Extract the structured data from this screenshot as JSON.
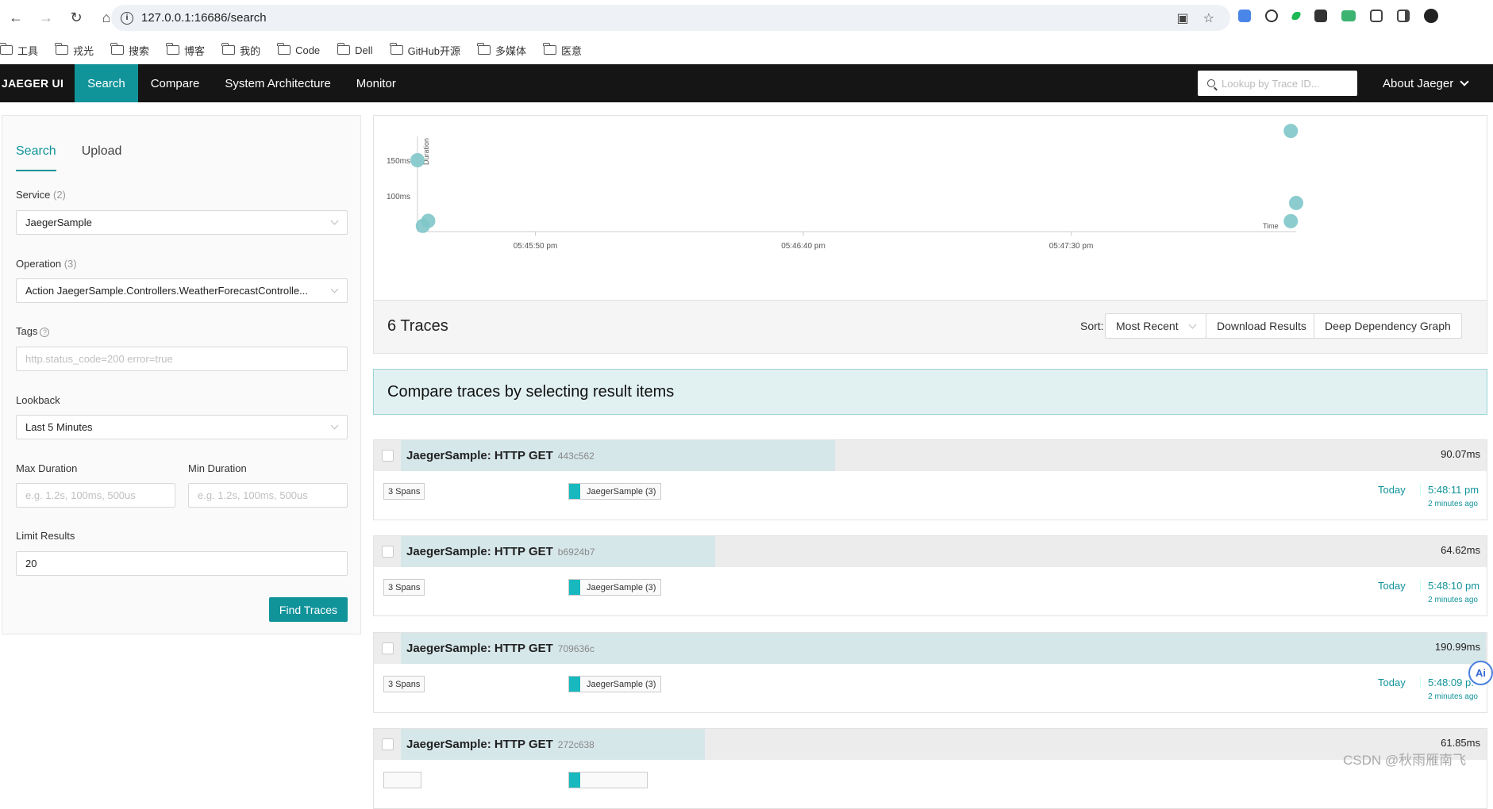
{
  "browser": {
    "url": "127.0.0.1:16686/search",
    "bookmarks": [
      "工具",
      "戎光",
      "搜索",
      "博客",
      "我的",
      "Code",
      "Dell",
      "GitHub开源",
      "多媒体",
      "医意"
    ]
  },
  "nav": {
    "brand": "JAEGER UI",
    "items": [
      "Search",
      "Compare",
      "System Architecture",
      "Monitor"
    ],
    "lookup_placeholder": "Lookup by Trace ID...",
    "about": "About Jaeger"
  },
  "form": {
    "tabs": [
      "Search",
      "Upload"
    ],
    "service_label": "Service",
    "service_count": "(2)",
    "service_value": "JaegerSample",
    "operation_label": "Operation",
    "operation_count": "(3)",
    "operation_value": "Action JaegerSample.Controllers.WeatherForecastControlle...",
    "tags_label": "Tags",
    "tags_help": "?",
    "tags_placeholder": "http.status_code=200 error=true",
    "lookback_label": "Lookback",
    "lookback_value": "Last 5 Minutes",
    "max_duration_label": "Max Duration",
    "max_duration_placeholder": "e.g. 1.2s, 100ms, 500us",
    "min_duration_label": "Min Duration",
    "min_duration_placeholder": "e.g. 1.2s, 100ms, 500us",
    "limit_label": "Limit Results",
    "limit_value": "20",
    "find_button": "Find Traces"
  },
  "chart_data": {
    "type": "scatter",
    "ylabel": "Duration",
    "xlabel": "Time",
    "y_ticks": [
      "150ms",
      "100ms"
    ],
    "x_ticks": [
      "05:45:50 pm",
      "05:46:40 pm",
      "05:47:30 pm"
    ],
    "x_unit": "seconds after 05:45:28 pm",
    "series": [
      {
        "points": [
          {
            "x": 0,
            "y": 150
          },
          {
            "x": 2,
            "y": 65
          },
          {
            "x": 1,
            "y": 58
          },
          {
            "x": 163,
            "y": 190.99
          },
          {
            "x": 164,
            "y": 90.07
          },
          {
            "x": 163,
            "y": 64.62
          }
        ]
      }
    ],
    "color": "#7fc7c9"
  },
  "results": {
    "title": "6 Traces",
    "sort_label": "Sort:",
    "sort_value": "Most Recent",
    "download_button": "Download Results",
    "ddg_button": "Deep Dependency Graph",
    "compare_banner": "Compare traces by selecting result items"
  },
  "traces": [
    {
      "name": "JaegerSample: HTTP GET",
      "id": "443c562",
      "duration": "90.07ms",
      "fill_fraction": 0.4,
      "spans": "3 Spans",
      "service": "JaegerSample (3)",
      "day": "Today",
      "time": "5:48:11 pm",
      "ago": "2 minutes ago"
    },
    {
      "name": "JaegerSample: HTTP GET",
      "id": "b6924b7",
      "duration": "64.62ms",
      "fill_fraction": 0.29,
      "spans": "3 Spans",
      "service": "JaegerSample (3)",
      "day": "Today",
      "time": "5:48:10 pm",
      "ago": "2 minutes ago"
    },
    {
      "name": "JaegerSample: HTTP GET",
      "id": "709636c",
      "duration": "190.99ms",
      "fill_fraction": 1.0,
      "spans": "3 Spans",
      "service": "JaegerSample (3)",
      "day": "Today",
      "time": "5:48:09 p.",
      "ago": "2 minutes ago"
    },
    {
      "name": "JaegerSample: HTTP GET",
      "id": "272c638",
      "duration": "61.85ms",
      "fill_fraction": 0.28,
      "spans": "",
      "service": "",
      "day": "",
      "time": "",
      "ago": ""
    }
  ],
  "ai_badge": "Ai",
  "watermark": "CSDN @秋雨雁南飞"
}
